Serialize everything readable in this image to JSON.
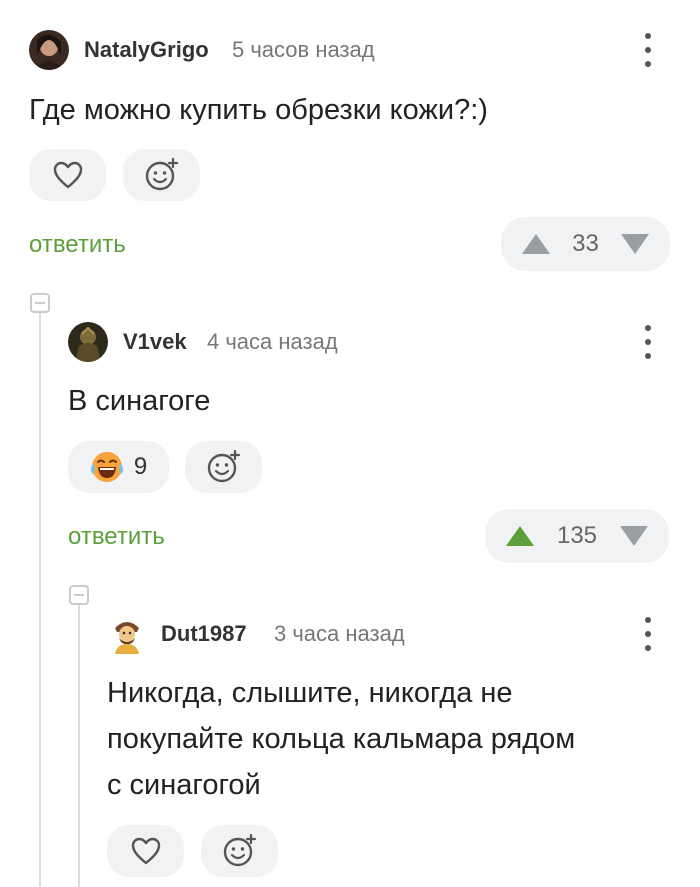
{
  "colors": {
    "accent_green": "#5ba03a",
    "pill_bg": "#f1f2f4",
    "thread_line": "#d9dbde"
  },
  "comments": [
    {
      "username": "NatalyGrigo",
      "time": "5 часов назад",
      "text": "Где можно купить обрезки кожи?:)",
      "reply_label": "ответить",
      "votes": "33"
    },
    {
      "username": "V1vek",
      "time": "4 часа назад",
      "text": "В синагоге",
      "reaction_count": "9",
      "reply_label": "ответить",
      "votes": "135"
    },
    {
      "username": "Dut1987",
      "time": "3 часа назад",
      "text_lines": [
        "Никогда, слышите, никогда не",
        "покупайте кольца кальмара рядом",
        "с синагогой"
      ]
    }
  ]
}
